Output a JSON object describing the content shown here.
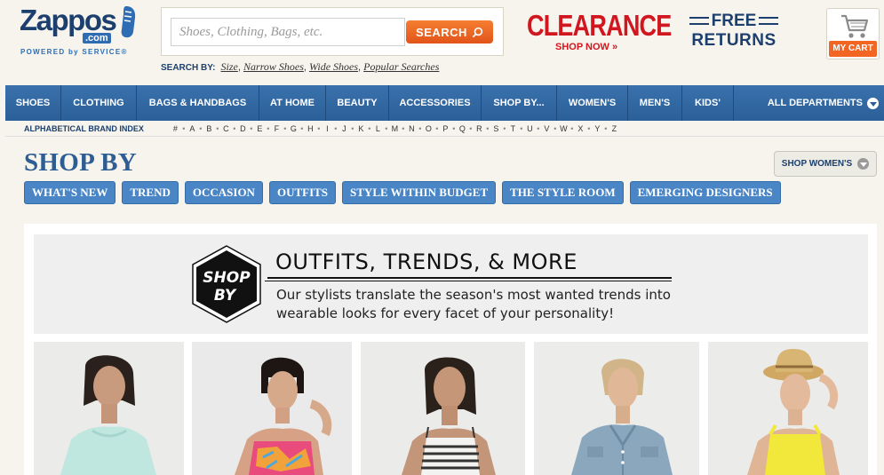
{
  "header": {
    "logo": {
      "word": "Zappos",
      "com": ".com",
      "tagline": "POWERED by SERVICE®"
    },
    "search": {
      "placeholder": "Shoes, Clothing, Bags, etc.",
      "button_label": "SEARCH"
    },
    "search_by": {
      "label": "SEARCH BY:",
      "links": [
        "Size",
        "Narrow Shoes",
        "Wide Shoes",
        "Popular Searches"
      ]
    },
    "clearance": {
      "title": "CLEARANCE",
      "cta": "SHOP NOW »"
    },
    "returns": {
      "line1": "FREE",
      "line2": "RETURNS"
    },
    "cart": {
      "label": "MY CART"
    }
  },
  "nav": {
    "items": [
      "SHOES",
      "CLOTHING",
      "BAGS & HANDBAGS",
      "AT HOME",
      "BEAUTY",
      "ACCESSORIES",
      "SHOP BY...",
      "WOMEN'S",
      "MEN'S",
      "KIDS'"
    ],
    "all_departments": "ALL DEPARTMENTS"
  },
  "alpha_index": {
    "label": "ALPHABETICAL BRAND INDEX",
    "letters": [
      "#",
      "A",
      "B",
      "C",
      "D",
      "E",
      "F",
      "G",
      "H",
      "I",
      "J",
      "K",
      "L",
      "M",
      "N",
      "O",
      "P",
      "Q",
      "R",
      "S",
      "T",
      "U",
      "V",
      "W",
      "X",
      "Y",
      "Z"
    ]
  },
  "shopby": {
    "title": "SHOP BY",
    "shop_womens": "SHOP WOMEN'S",
    "pills": [
      "WHAT'S NEW",
      "TREND",
      "OCCASION",
      "OUTFITS",
      "STYLE WITHIN BUDGET",
      "THE STYLE ROOM",
      "EMERGING DESIGNERS"
    ]
  },
  "banner": {
    "badge_line1": "SHOP",
    "badge_line2": "BY",
    "title": "OUTFITS, TRENDS, & MORE",
    "subtitle_line1": "Our stylists translate the season's most wanted trends into",
    "subtitle_line2": "wearable looks for every facet of your personality!"
  },
  "colors": {
    "nav_blue": "#2b5f98",
    "pill_blue": "#4a86c5",
    "orange": "#f26522",
    "clearance_red": "#d1161f",
    "navy": "#1c3f6e"
  }
}
